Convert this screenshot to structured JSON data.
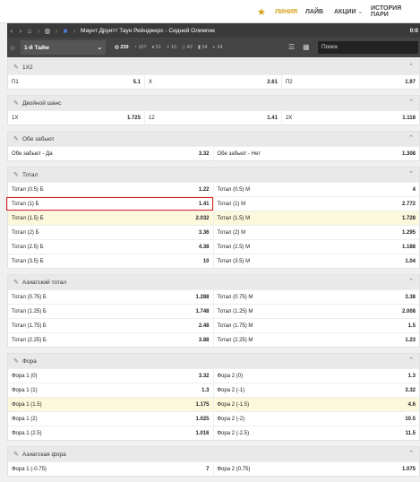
{
  "top_nav": {
    "star": "★",
    "items": [
      "ЛИНИЯ",
      "ЛАЙВ",
      "АКЦИИ",
      "ИСТОРИЯ ПАРИ"
    ],
    "accent": "#d4a017"
  },
  "match_bar": {
    "title": "Маунт Друитт Таун Рейнджерс - Сидней Олимпик",
    "score": "0:0"
  },
  "toolbar": {
    "period": "1-й Тайм",
    "counts": [
      "239",
      "107",
      "51",
      "10",
      "42",
      "54",
      "24"
    ],
    "search_placeholder": "Поиск"
  },
  "sections": [
    {
      "id": "1x2",
      "title": "1X2",
      "cols": 3,
      "rows": [
        {
          "hl": false,
          "cells": [
            {
              "l": "П1",
              "v": "5.1"
            },
            {
              "l": "X",
              "v": "2.61"
            },
            {
              "l": "П2",
              "v": "1.97"
            }
          ]
        }
      ]
    },
    {
      "id": "double",
      "title": "Двойной шанс",
      "cols": 3,
      "rows": [
        {
          "hl": false,
          "cells": [
            {
              "l": "1X",
              "v": "1.725"
            },
            {
              "l": "12",
              "v": "1.41"
            },
            {
              "l": "2X",
              "v": "1.118"
            }
          ]
        }
      ]
    },
    {
      "id": "both",
      "title": "Обе забьют",
      "cols": 2,
      "rows": [
        {
          "hl": false,
          "cells": [
            {
              "l": "Обе забьют - Да",
              "v": "3.32"
            },
            {
              "l": "Обе забьют - Нет",
              "v": "1.308"
            }
          ]
        }
      ]
    },
    {
      "id": "total",
      "title": "Тотал",
      "cols": 2,
      "rows": [
        {
          "hl": false,
          "cells": [
            {
              "l": "Тотал (0.5) Б",
              "v": "1.22"
            },
            {
              "l": "Тотал (0.5) М",
              "v": "4"
            }
          ]
        },
        {
          "hl": false,
          "boxed": true,
          "cells": [
            {
              "l": "Тотал (1) Б",
              "v": "1.41"
            },
            {
              "l": "Тотал (1) М",
              "v": "2.772"
            }
          ]
        },
        {
          "hl": true,
          "cells": [
            {
              "l": "Тотал (1.5) Б",
              "v": "2.032"
            },
            {
              "l": "Тотал (1.5) М",
              "v": "1.728"
            }
          ]
        },
        {
          "hl": false,
          "cells": [
            {
              "l": "Тотал (2) Б",
              "v": "3.36"
            },
            {
              "l": "Тотал (2) М",
              "v": "1.295"
            }
          ]
        },
        {
          "hl": false,
          "cells": [
            {
              "l": "Тотал (2.5) Б",
              "v": "4.38"
            },
            {
              "l": "Тотал (2.5) М",
              "v": "1.188"
            }
          ]
        },
        {
          "hl": false,
          "cells": [
            {
              "l": "Тотал (3.5) Б",
              "v": "10"
            },
            {
              "l": "Тотал (3.5) М",
              "v": "1.04"
            }
          ]
        }
      ]
    },
    {
      "id": "asian_total",
      "title": "Азиатский тотал",
      "cols": 2,
      "rows": [
        {
          "hl": false,
          "cells": [
            {
              "l": "Тотал (0.75) Б",
              "v": "1.288"
            },
            {
              "l": "Тотал (0.75) М",
              "v": "3.38"
            }
          ]
        },
        {
          "hl": false,
          "cells": [
            {
              "l": "Тотал (1.25) Б",
              "v": "1.748"
            },
            {
              "l": "Тотал (1.25) М",
              "v": "2.008"
            }
          ]
        },
        {
          "hl": false,
          "cells": [
            {
              "l": "Тотал (1.75) Б",
              "v": "2.48"
            },
            {
              "l": "Тотал (1.75) М",
              "v": "1.5"
            }
          ]
        },
        {
          "hl": false,
          "cells": [
            {
              "l": "Тотал (2.25) Б",
              "v": "3.88"
            },
            {
              "l": "Тотал (2.25) М",
              "v": "1.23"
            }
          ]
        }
      ]
    },
    {
      "id": "fora",
      "title": "Фора",
      "cols": 2,
      "rows": [
        {
          "hl": false,
          "cells": [
            {
              "l": "Фора 1 (0)",
              "v": "3.32"
            },
            {
              "l": "Фора 2 (0)",
              "v": "1.3"
            }
          ]
        },
        {
          "hl": false,
          "cells": [
            {
              "l": "Фора 1 (1)",
              "v": "1.3"
            },
            {
              "l": "Фора 2 (-1)",
              "v": "3.32"
            }
          ]
        },
        {
          "hl": true,
          "cells": [
            {
              "l": "Фора 1 (1.5)",
              "v": "1.175"
            },
            {
              "l": "Фора 2 (-1.5)",
              "v": "4.6"
            }
          ]
        },
        {
          "hl": false,
          "cells": [
            {
              "l": "Фора 1 (2)",
              "v": "1.025"
            },
            {
              "l": "Фора 2 (-2)",
              "v": "10.5"
            }
          ]
        },
        {
          "hl": false,
          "cells": [
            {
              "l": "Фора 1 (2.5)",
              "v": "1.016"
            },
            {
              "l": "Фора 2 (-2.5)",
              "v": "11.5"
            }
          ]
        }
      ]
    },
    {
      "id": "asian_fora",
      "title": "Азиатская фора",
      "cols": 2,
      "rows": [
        {
          "hl": false,
          "cells": [
            {
              "l": "Фора 1 (-0.75)",
              "v": "7"
            },
            {
              "l": "Фора 2 (0.75)",
              "v": "1.075"
            }
          ]
        }
      ]
    }
  ]
}
